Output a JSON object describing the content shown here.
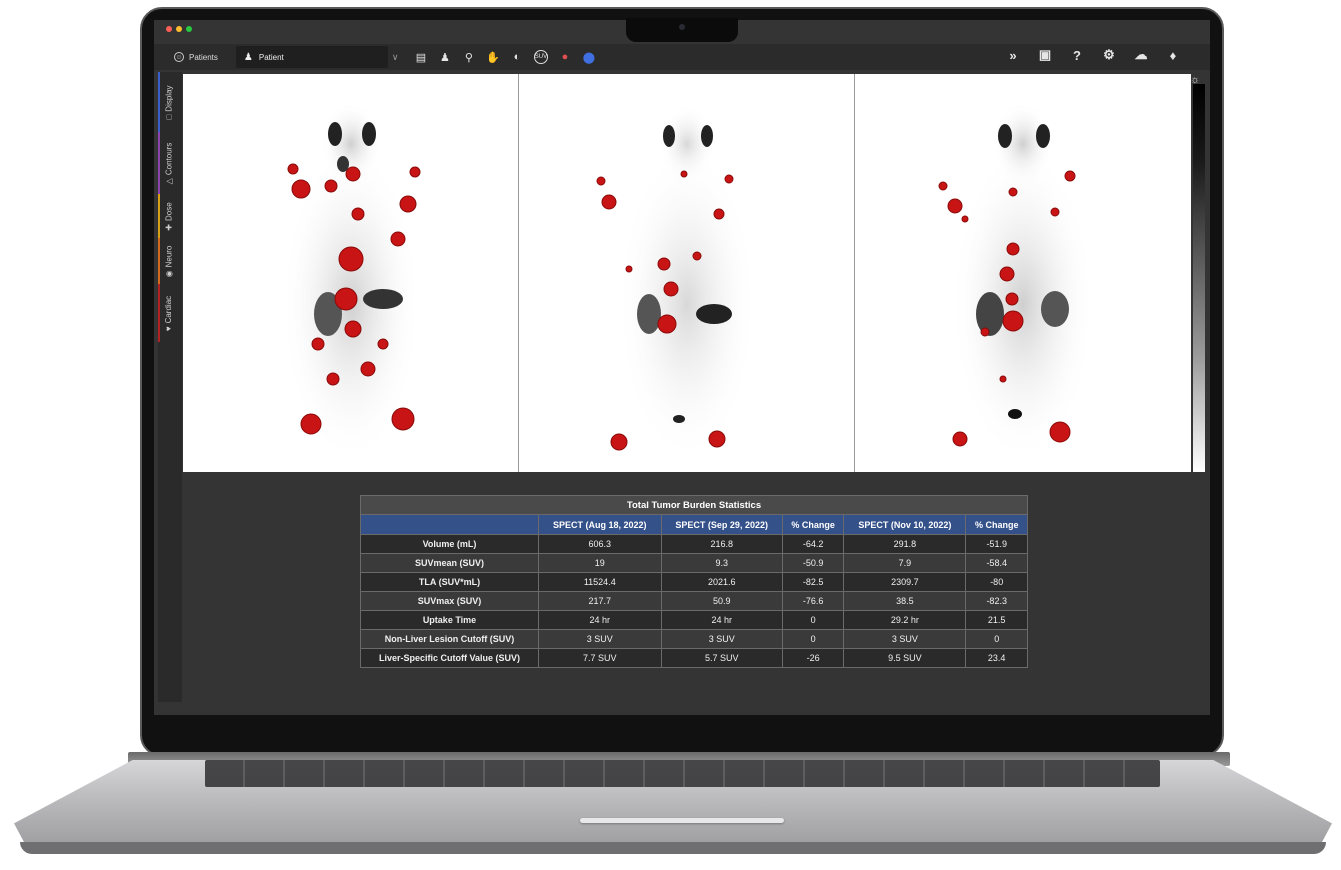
{
  "toolbar": {
    "patients_label": "Patients",
    "patient_tab_label": "Patient",
    "tools": [
      "save-icon",
      "users-icon",
      "search-people-icon",
      "hand-icon",
      "contrast-icon",
      "suv-icon",
      "pill-icon",
      "circle-icon"
    ],
    "suv_text": "SUV",
    "right_tools": [
      "expand-icon",
      "camera-icon",
      "help-icon",
      "settings-icon",
      "cloud-icon",
      "bell-icon"
    ]
  },
  "side_tabs": [
    {
      "label": "Display",
      "color": "#3a5fcd"
    },
    {
      "label": "Contours",
      "color": "#8e44ad"
    },
    {
      "label": "Dose",
      "color": "#d4a017"
    },
    {
      "label": "Neuro",
      "color": "#d2691e"
    },
    {
      "label": "Cardiac",
      "color": "#b22222"
    }
  ],
  "stats_table": {
    "title": "Total Tumor Burden Statistics",
    "headers": [
      "",
      "SPECT (Aug 18, 2022)",
      "SPECT (Sep 29, 2022)",
      "% Change",
      "SPECT (Nov 10, 2022)",
      "% Change"
    ],
    "rows": [
      [
        "Volume (mL)",
        "606.3",
        "216.8",
        "-64.2",
        "291.8",
        "-51.9"
      ],
      [
        "SUVmean (SUV)",
        "19",
        "9.3",
        "-50.9",
        "7.9",
        "-58.4"
      ],
      [
        "TLA (SUV*mL)",
        "11524.4",
        "2021.6",
        "-82.5",
        "2309.7",
        "-80"
      ],
      [
        "SUVmax (SUV)",
        "217.7",
        "50.9",
        "-76.6",
        "38.5",
        "-82.3"
      ],
      [
        "Uptake Time",
        "24 hr",
        "24 hr",
        "0",
        "29.2 hr",
        "21.5"
      ],
      [
        "Non-Liver Lesion Cutoff (SUV)",
        "3 SUV",
        "3 SUV",
        "0",
        "3 SUV",
        "0"
      ],
      [
        "Liver-Specific Cutoff Value (SUV)",
        "7.7 SUV",
        "5.7 SUV",
        "-26",
        "9.5 SUV",
        "23.4"
      ]
    ]
  },
  "colors": {
    "lesion": "#d21b1b",
    "header_blue": "#35518a",
    "background": "#343434"
  }
}
